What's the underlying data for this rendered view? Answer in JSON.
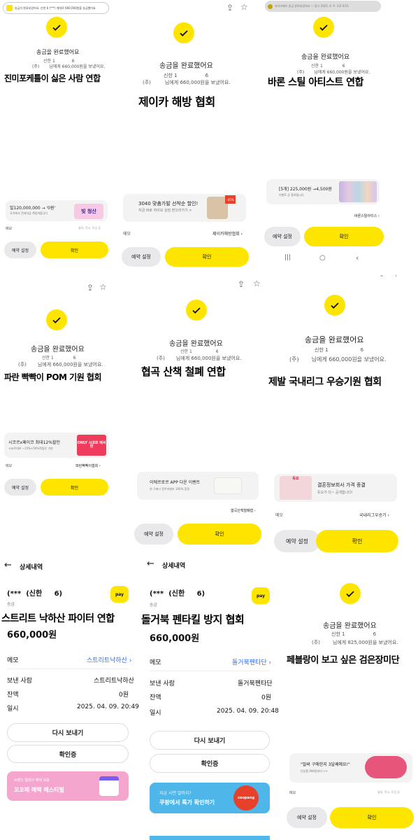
{
  "common": {
    "done_title": "송금을 완료했어요",
    "reserve_label": "예약 설정",
    "confirm_label": "확인",
    "memo_label": "메모",
    "detail_title": "상세내역",
    "bank_short": "신한 1",
    "acct_tail": "6",
    "recipient_corp": "(주)",
    "sent_text_660": "님에게 660,000원을 보냈어요.",
    "sent_text_825": "님에게 825,000원을 보냈어요.",
    "amount": "660,000원",
    "resend": "다시 보내기",
    "checking": "확인증",
    "sender_label": "보낸 사람",
    "balance_label": "잔액",
    "balance_value": "0원",
    "datetime_label": "일시",
    "send_label": "송금",
    "pay_badge": "pay",
    "detail_header": "(***  (신한     6)"
  },
  "p1": {
    "notif": "송금이 완료되었어요. 신한 6 (***) 계좌로 660,000원을 송금했어요",
    "caption": "진미포케틀이 싫은 사람 연합",
    "ad_title": "빌120,000,000 → '0원'",
    "ad_sub": "국가에서 전세자금 책임져줍니다",
    "ad_badge": "빚 청산",
    "memo_hint": "월세, 학교, 모임 등"
  },
  "p2": {
    "caption": "제이카 해방 협회",
    "ad_title": "3040 맞춤가발 선착순 할인!",
    "ad_sub": "지금 바로 하이모 상담 받으러가기 >",
    "ad_badge": "-45%",
    "memo_value": "제이카해방협회"
  },
  "p3": {
    "notif": "카카오페이 송금 완료되었어요 — 일시 2025. 4. 9. 오후 8:51",
    "caption": "바론 스틸 아티스트 연합",
    "ad_title": "[5개] 225,000원 →4,500원",
    "ad_sub": "이벤트 곧 종료됩니다",
    "memo_value": "바론스틸아티스"
  },
  "p4": {
    "caption": "파란 빡빡이 POM 기원 협회",
    "ad_title": "시코르x페이코 최대12%할인",
    "ad_sub": "시코르대비 ~15%+50%적립은 기본",
    "ad_badge": "ONLY 시코르 에서만",
    "memo_value": "파란빡빡이협회"
  },
  "p5": {
    "caption": "협곡 산책 철폐 연합",
    "ad_title": "이에르로르 APP 다운 이벤트",
    "ad_sub": "첫 구매시 전주카넬라 100% 증정",
    "memo_value": "협곡산책철폐협"
  },
  "p6": {
    "caption": "제발 국내리그 우승기원 협회",
    "ad_title": "결혼정보회사 가격 종결",
    "ad_sub": "듀오가 다~ 공개합니다!",
    "ad_badge": "듀오",
    "memo_value": "국내리그우승기"
  },
  "p7": {
    "caption": "스트리트 낙하산 파이터 연합",
    "memo_value": "스트리트낙하산",
    "sender_value": "스트리트낙하산",
    "datetime_value": "2025. 04. 09. 20:49",
    "promo_small": "브랜드 릴레이 혜택 모음",
    "promo_title": "꼬꼬페 혜택 페스티벌"
  },
  "p8": {
    "caption": "돌거북 펜타킬 방지 협회",
    "memo_value": "돌거북펜타단",
    "sender_value": "돌거북펜타단",
    "datetime_value": "2025. 04. 09. 20:48",
    "promo_small": "지금 사면 얼마지?",
    "promo_title": "쿠팡에서 특가 확인하기",
    "promo_badge": "coupang"
  },
  "p9": {
    "caption": "페블랑이 보고 싶은 검은장미단",
    "ad_title": "\"벌써 구매한지 3달째예요!\"",
    "ad_sub": "인상품 900원부터 >>",
    "memo_hint": "월세, 학교, 모임 등"
  },
  "colors": {
    "yellow": "#FEE500",
    "kakao_blue": "#2a6df5",
    "pink": "#f4a6cf",
    "sky": "#4fb6ea"
  }
}
